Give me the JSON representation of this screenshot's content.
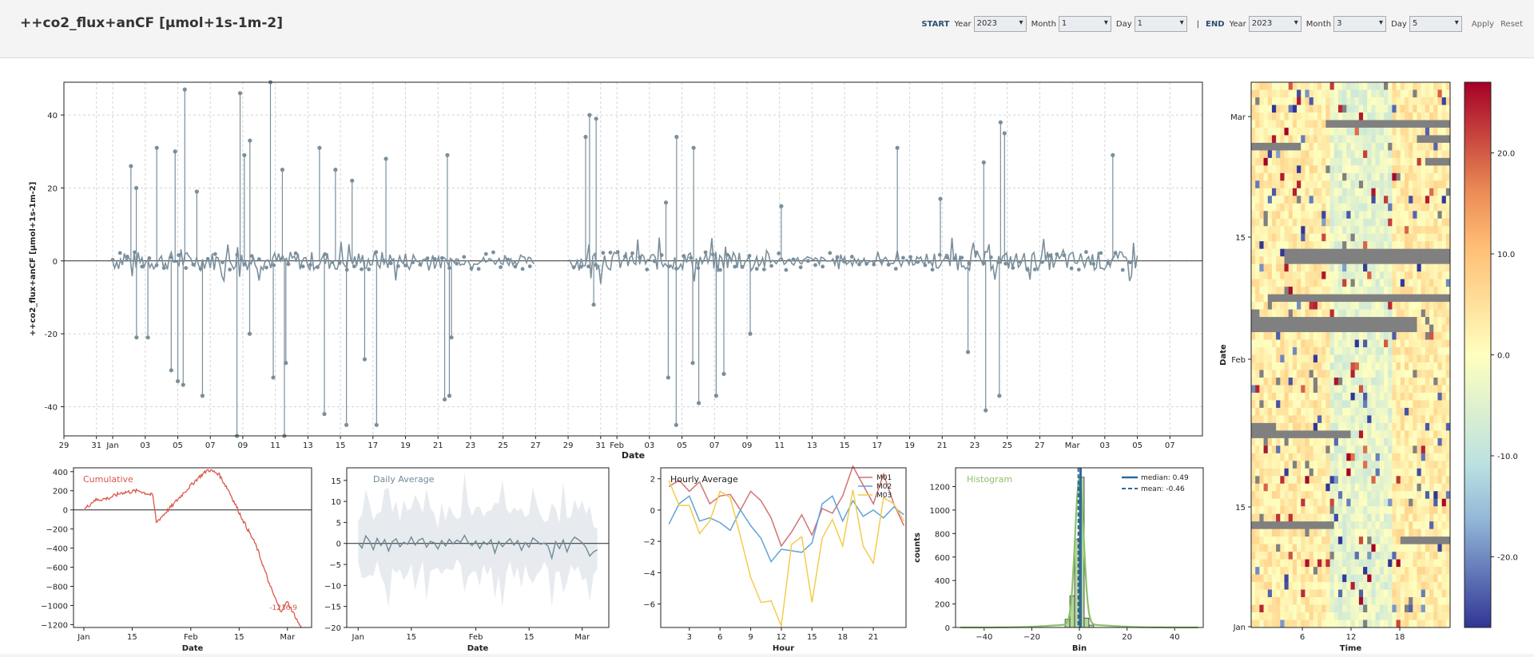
{
  "header": {
    "title": "++co2_flux+anCF [µmol+1s-1m-2]",
    "start": {
      "label": "START",
      "year_label": "Year",
      "year": "2023",
      "month_label": "Month",
      "month": "1",
      "day_label": "Day",
      "day": "1"
    },
    "separator": "|",
    "end": {
      "label": "END",
      "year_label": "Year",
      "year": "2023",
      "month_label": "Month",
      "month": "3",
      "day_label": "Day",
      "day": "5"
    },
    "apply": "Apply",
    "reset": "Reset"
  },
  "chart_data": [
    {
      "id": "main",
      "type": "line",
      "xlabel": "Date",
      "ylabel": "++co2_flux+anCF [µmol+1s-1m-2]",
      "ylim": [
        -48,
        49
      ],
      "grid": true,
      "x_tick_labels": [
        "29",
        "31",
        "Jan",
        "03",
        "05",
        "07",
        "09",
        "11",
        "13",
        "15",
        "17",
        "19",
        "21",
        "23",
        "25",
        "27",
        "29",
        "31",
        "Feb",
        "03",
        "05",
        "07",
        "09",
        "11",
        "13",
        "15",
        "17",
        "19",
        "21",
        "23",
        "25",
        "27",
        "Mar",
        "03",
        "05",
        "07"
      ],
      "y_ticks": [
        -40,
        -20,
        0,
        20,
        40
      ],
      "color": "#7a8f9c",
      "data_start": "Jan 01",
      "data_end": "Mar 05",
      "gap": [
        "Jan 27",
        "Jan 29"
      ],
      "spikes": [
        {
          "date": "Jan 02",
          "value": 20
        },
        {
          "date": "Jan 02",
          "value": -21
        },
        {
          "date": "Jan 02",
          "value": 26
        },
        {
          "date": "Jan 03",
          "value": -21
        },
        {
          "date": "Jan 03",
          "value": 31
        },
        {
          "date": "Jan 04",
          "value": 30
        },
        {
          "date": "Jan 04",
          "value": -30
        },
        {
          "date": "Jan 05",
          "value": -33
        },
        {
          "date": "Jan 05",
          "value": 47
        },
        {
          "date": "Jan 05",
          "value": -34
        },
        {
          "date": "Jan 06",
          "value": -37
        },
        {
          "date": "Jan 06",
          "value": 19
        },
        {
          "date": "Jan 08",
          "value": -48
        },
        {
          "date": "Jan 08",
          "value": 46
        },
        {
          "date": "Jan 09",
          "value": 33
        },
        {
          "date": "Jan 09",
          "value": 29
        },
        {
          "date": "Jan 09",
          "value": -20
        },
        {
          "date": "Jan 10",
          "value": 49
        },
        {
          "date": "Jan 10",
          "value": -32
        },
        {
          "date": "Jan 11",
          "value": -48
        },
        {
          "date": "Jan 11",
          "value": 25
        },
        {
          "date": "Jan 11",
          "value": -28
        },
        {
          "date": "Jan 13",
          "value": 31
        },
        {
          "date": "Jan 14",
          "value": -42
        },
        {
          "date": "Jan 14",
          "value": 25
        },
        {
          "date": "Jan 15",
          "value": -45
        },
        {
          "date": "Jan 15",
          "value": 22
        },
        {
          "date": "Jan 16",
          "value": -27
        },
        {
          "date": "Jan 17",
          "value": 28
        },
        {
          "date": "Jan 17",
          "value": -45
        },
        {
          "date": "Jan 21",
          "value": -38
        },
        {
          "date": "Jan 21",
          "value": 29
        },
        {
          "date": "Jan 21",
          "value": -37
        },
        {
          "date": "Jan 21",
          "value": -21
        },
        {
          "date": "Jan 30",
          "value": 34
        },
        {
          "date": "Jan 30",
          "value": 39
        },
        {
          "date": "Jan 30",
          "value": 40
        },
        {
          "date": "Jan 30",
          "value": -12
        },
        {
          "date": "Feb 04",
          "value": 34
        },
        {
          "date": "Feb 04",
          "value": -32
        },
        {
          "date": "Feb 04",
          "value": -45
        },
        {
          "date": "Feb 04",
          "value": 16
        },
        {
          "date": "Feb 05",
          "value": 31
        },
        {
          "date": "Feb 05",
          "value": -28
        },
        {
          "date": "Feb 06",
          "value": -39
        },
        {
          "date": "Feb 07",
          "value": -31
        },
        {
          "date": "Feb 07",
          "value": -37
        },
        {
          "date": "Feb 09",
          "value": -20
        },
        {
          "date": "Feb 11",
          "value": 15
        },
        {
          "date": "Feb 18",
          "value": 31
        },
        {
          "date": "Feb 20",
          "value": 17
        },
        {
          "date": "Feb 22",
          "value": -25
        },
        {
          "date": "Feb 23",
          "value": 27
        },
        {
          "date": "Feb 23",
          "value": -41
        },
        {
          "date": "Feb 24",
          "value": 38
        },
        {
          "date": "Feb 24",
          "value": -37
        },
        {
          "date": "Feb 24",
          "value": 35
        },
        {
          "date": "Mar 03",
          "value": 29
        }
      ]
    },
    {
      "id": "cumulative",
      "type": "line",
      "title": "Cumulative",
      "color": "#d9584a",
      "xlabel": "Date",
      "x_tick_labels": [
        "Jan",
        "15",
        "Feb",
        "15",
        "Mar"
      ],
      "ylim": [
        -1230,
        440
      ],
      "y_ticks": [
        -1200,
        -1000,
        -800,
        -600,
        -400,
        -200,
        0,
        200,
        400
      ],
      "annotation": "-1236.9",
      "points": [
        {
          "date": "Jan 01",
          "value": 0
        },
        {
          "date": "Jan 04",
          "value": 100
        },
        {
          "date": "Jan 08",
          "value": 120
        },
        {
          "date": "Jan 12",
          "value": 180
        },
        {
          "date": "Jan 17",
          "value": 200
        },
        {
          "date": "Jan 21",
          "value": 150
        },
        {
          "date": "Jan 22",
          "value": -130
        },
        {
          "date": "Jan 27",
          "value": 60
        },
        {
          "date": "Jan 30",
          "value": 180
        },
        {
          "date": "Feb 03",
          "value": 330
        },
        {
          "date": "Feb 06",
          "value": 420
        },
        {
          "date": "Feb 09",
          "value": 380
        },
        {
          "date": "Feb 12",
          "value": 200
        },
        {
          "date": "Feb 16",
          "value": -100
        },
        {
          "date": "Feb 20",
          "value": -380
        },
        {
          "date": "Feb 24",
          "value": -800
        },
        {
          "date": "Feb 27",
          "value": -1060
        },
        {
          "date": "Mar 01",
          "value": -960
        },
        {
          "date": "Mar 05",
          "value": -1236.9
        }
      ]
    },
    {
      "id": "daily",
      "type": "area",
      "title": "Daily Average",
      "color": "#6f8a96",
      "xlabel": "Date",
      "x_tick_labels": [
        "Jan",
        "15",
        "Feb",
        "15",
        "Mar"
      ],
      "ylim": [
        -20,
        18
      ],
      "y_ticks": [
        -20,
        -15,
        -10,
        -5,
        0,
        5,
        10,
        15
      ],
      "mean": [
        0.2,
        -1.1,
        1.8,
        0.6,
        -1.5,
        1.2,
        -0.5,
        0.9,
        -1.8,
        0.4,
        1.1,
        -0.8,
        0.3,
        -0.2,
        1.5,
        -0.4,
        0.8,
        1.2,
        -0.9,
        0.5,
        0.2,
        -1.3,
        0.7,
        -0.6,
        1.0,
        -0.1,
        0.8,
        0.3,
        1.9,
        0.2,
        -0.5,
        0.6,
        -1.2,
        0.4,
        -0.3,
        0.9,
        -2.3,
        0.5,
        -0.8,
        0.3,
        1.1,
        -0.4,
        0.7,
        -1.6,
        0.2,
        -0.9,
        1.3,
        0.6,
        -0.2,
        0.1,
        -0.6,
        -3.5,
        0.4,
        -1.2,
        0.8,
        -2.0,
        0.3,
        1.5,
        0.9,
        0.2,
        -1.0,
        -3.0,
        -2.0,
        -1.5
      ],
      "spread": [
        5,
        8,
        11,
        9,
        7,
        6,
        8,
        12,
        15,
        7,
        9,
        6,
        10,
        8,
        7,
        12,
        9,
        6,
        14,
        8,
        7,
        5,
        9,
        6,
        8,
        7,
        5,
        6,
        15,
        9,
        7,
        8,
        10,
        6,
        8,
        7,
        12,
        9,
        16,
        8,
        6,
        9,
        7,
        10,
        6,
        8,
        12,
        9,
        7,
        5,
        6,
        13,
        8,
        6,
        14,
        8,
        6,
        9,
        7,
        10,
        8,
        12,
        6,
        5
      ]
    },
    {
      "id": "hourly",
      "type": "line",
      "title": "Hourly Average",
      "xlabel": "Hour",
      "x_tick_labels": [
        "3",
        "6",
        "9",
        "12",
        "15",
        "18",
        "21"
      ],
      "ylim": [
        -7.5,
        2.7
      ],
      "y_ticks": [
        -6,
        -4,
        -2,
        0,
        2
      ],
      "series": [
        {
          "name": "M01",
          "color": "#d27373",
          "values": [
            1.5,
            1.9,
            1.2,
            1.8,
            0.4,
            0.9,
            1.0,
            0.0,
            1.2,
            0.6,
            -0.5,
            -2.3,
            -1.4,
            -0.3,
            -1.6,
            0.1,
            -0.2,
            0.9,
            2.8,
            1.6,
            0.4,
            2.3,
            0.4,
            -1.0
          ]
        },
        {
          "name": "M02",
          "color": "#60a3d8",
          "values": [
            -0.9,
            0.4,
            0.9,
            -0.7,
            -0.5,
            -0.8,
            -1.3,
            0.0,
            -1.0,
            -1.8,
            -3.3,
            -2.5,
            -2.6,
            -2.7,
            -2.1,
            0.4,
            0.9,
            -0.7,
            0.6,
            -0.4,
            0.0,
            -0.5,
            0.2,
            -0.3
          ]
        },
        {
          "name": "M03",
          "color": "#f4cc4d",
          "values": [
            1.9,
            0.3,
            0.3,
            -1.5,
            -0.7,
            1.2,
            0.8,
            -1.7,
            -4.3,
            -5.9,
            -5.8,
            -7.4,
            -2.2,
            -1.7,
            -5.9,
            -1.8,
            -0.6,
            -2.3,
            1.3,
            -2.3,
            -3.4,
            0.8,
            0.4,
            -0.7
          ]
        }
      ]
    },
    {
      "id": "histogram",
      "type": "bar",
      "title": "Histogram",
      "color": "#8cc26a",
      "xlabel": "Bin",
      "ylabel": "counts",
      "x_tick_labels": [
        "−40",
        "−20",
        "0",
        "20",
        "40"
      ],
      "y_ticks": [
        0,
        200,
        400,
        600,
        800,
        1000,
        1200
      ],
      "xlim": [
        -52,
        52
      ],
      "ylim": [
        0,
        1360
      ],
      "bins": [
        {
          "x": -5,
          "count": 70
        },
        {
          "x": -3,
          "count": 270
        },
        {
          "x": -1,
          "count": 750
        },
        {
          "x": 1,
          "count": 1280
        },
        {
          "x": 3,
          "count": 80
        },
        {
          "x": 5,
          "count": 20
        }
      ],
      "median": 0.49,
      "mean": -0.46,
      "legend": [
        "median: 0.49",
        "mean: -0.46"
      ]
    },
    {
      "id": "heatmap",
      "type": "heatmap",
      "xlabel": "Time",
      "ylabel": "Date",
      "x_tick_labels": [
        "6",
        "12",
        "18"
      ],
      "y_tick_labels": [
        "Mar",
        "15",
        "Feb",
        "15",
        "Jan"
      ],
      "colorbar_ticks": [
        "20.0",
        "10.0",
        "0.0",
        "-10.0",
        "-20.0"
      ],
      "colorbar_range": [
        -27,
        27
      ]
    }
  ]
}
